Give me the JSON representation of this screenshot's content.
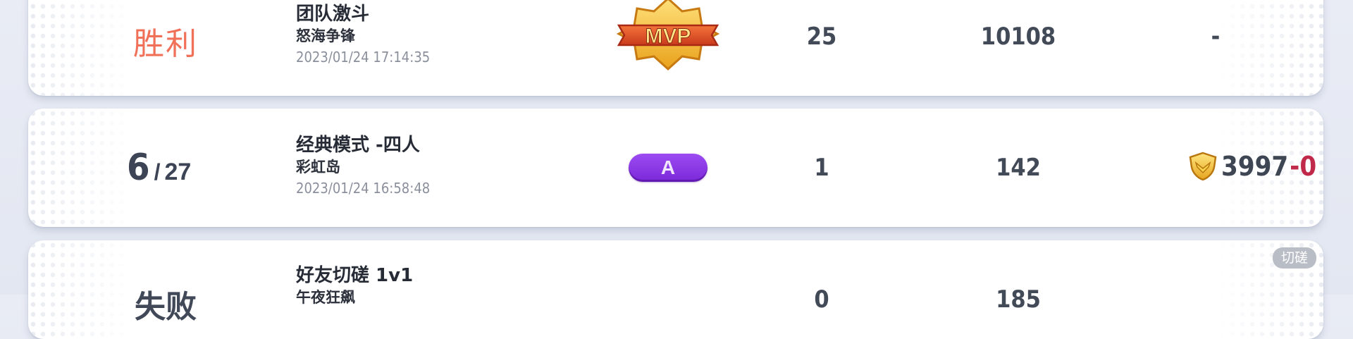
{
  "rows": [
    {
      "result": "胜利",
      "mode": "团队激斗",
      "map": "怒海争锋",
      "time": "2023/01/24 17:14:35",
      "badge": "MVP",
      "col_a": "25",
      "col_b": "10108",
      "col_c": "-",
      "tag": ""
    },
    {
      "rank": "6",
      "rank_sep": "/",
      "rank_total": "27",
      "mode": "经典模式 -四人",
      "map": "彩虹岛",
      "time": "2023/01/24 16:58:48",
      "grade": "A",
      "col_a": "1",
      "col_b": "142",
      "points": "3997",
      "points_delta": "-0"
    },
    {
      "result": "失败",
      "mode": "好友切磋 1v1",
      "map": "午夜狂飙",
      "time": "",
      "col_a": "0",
      "col_b": "185",
      "tag": "切磋"
    }
  ],
  "icons": {
    "mvp_badge": "mvp-badge-icon",
    "rank_shield": "gold-shield-icon"
  },
  "colors": {
    "win": "#f07058",
    "grade_purple": "#8a38e4",
    "delta_red": "#c0294a",
    "mvp_orange": "#e8562a",
    "mvp_gold": "#f6c23a"
  }
}
